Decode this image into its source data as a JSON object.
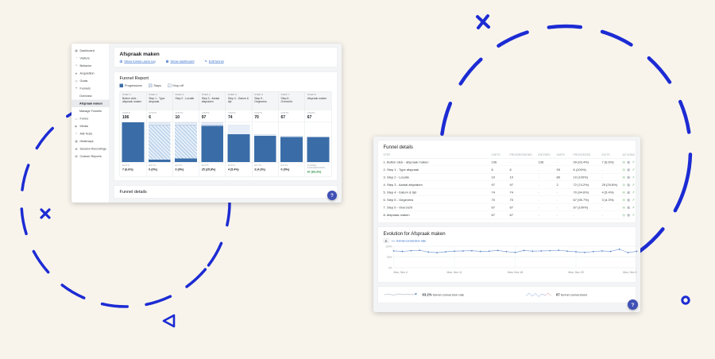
{
  "canvas": {
    "background": "#f8f4ec",
    "doodle_color": "#1c2bd3",
    "accent_blue": "#3f51b5"
  },
  "left_window": {
    "sidebar": {
      "items": [
        {
          "label": "Dashboard",
          "icon": "▦"
        },
        {
          "label": "Visitors",
          "icon": "◔"
        },
        {
          "label": "Behavior",
          "icon": "≡"
        },
        {
          "label": "Acquisition",
          "icon": "◈"
        },
        {
          "label": "Goals",
          "icon": "◎"
        },
        {
          "label": "Funnels",
          "icon": "⏷"
        },
        {
          "label": "Overview",
          "icon": "",
          "sub": true
        },
        {
          "label": "Afspraak maken",
          "icon": "",
          "sub": true,
          "active": true
        },
        {
          "label": "Manage Funnels",
          "icon": "",
          "sub": true
        },
        {
          "label": "Forms",
          "icon": "▭"
        },
        {
          "label": "Media",
          "icon": "▶"
        },
        {
          "label": "A/B Tests",
          "icon": "⌗"
        },
        {
          "label": "Heatmaps",
          "icon": "▩"
        },
        {
          "label": "Session Recordings",
          "icon": "◉"
        },
        {
          "label": "Custom Reports",
          "icon": "▤"
        }
      ]
    },
    "header": {
      "title": "Afspraak maken",
      "links": [
        {
          "icon": "▥",
          "label": "Show funnel users log"
        },
        {
          "icon": "▦",
          "label": "Show dashboard"
        },
        {
          "icon": "✎",
          "label": "Edit funnel"
        }
      ]
    },
    "report": {
      "title": "Funnel Report",
      "legend": [
        {
          "label": "Progressions",
          "type": "solid"
        },
        {
          "label": "Stays",
          "type": "hatch"
        },
        {
          "label": "Drop-off",
          "type": "light"
        }
      ],
      "visits_label": "VISITS",
      "exits_label": "EXITS",
      "conversions_label": "FUNNEL CONVERSIONS",
      "footer_label": "Funnel details",
      "help_label": "?"
    }
  },
  "right_window": {
    "details": {
      "title": "Funnel details",
      "columns": [
        "STEP",
        "VISITS",
        "PROGRESSIONS",
        "ENTRIES",
        "SKIPS",
        "PROCEEDED",
        "EXITS",
        "ACTIONS"
      ],
      "rows": [
        {
          "step": "1. Button click - afspraak maken",
          "visits": "106",
          "progressions": "-",
          "entries": "106",
          "skips": "-",
          "proceeded": "99 (93.4%)",
          "exits": "7 (6.6%)"
        },
        {
          "step": "2. Step 1 - Type afspraak",
          "visits": "6",
          "progressions": "6",
          "entries": "-",
          "skips": "93",
          "proceeded": "6 (100%)",
          "exits": "-"
        },
        {
          "step": "3. Step 2 - Locatie",
          "visits": "10",
          "progressions": "10",
          "entries": "-",
          "skips": "89",
          "proceeded": "10 (100%)",
          "exits": "-"
        },
        {
          "step": "4. Step 3 - Aantal afspraken",
          "visits": "97",
          "progressions": "97",
          "entries": "-",
          "skips": "2",
          "proceeded": "72 (74.2%)",
          "exits": "25 (25.8%)"
        },
        {
          "step": "5. Step 4 - Datum & tijd",
          "visits": "74",
          "progressions": "74",
          "entries": "-",
          "skips": "-",
          "proceeded": "70 (94.6%)",
          "exits": "4 (5.4%)"
        },
        {
          "step": "6. Step 5 - Gegevens",
          "visits": "70",
          "progressions": "70",
          "entries": "-",
          "skips": "-",
          "proceeded": "67 (95.7%)",
          "exits": "3 (4.3%)"
        },
        {
          "step": "7. Step 6 - Overzicht",
          "visits": "67",
          "progressions": "67",
          "entries": "-",
          "skips": "-",
          "proceeded": "67 (100%)",
          "exits": "-"
        },
        {
          "step": "8. Afspraak maken",
          "visits": "67",
          "progressions": "67",
          "entries": "-",
          "skips": "-",
          "proceeded": "-",
          "exits": "-"
        }
      ],
      "action_icons": [
        {
          "glyph": "◎",
          "name": "segment-icon",
          "color": "#6fae73"
        },
        {
          "glyph": "▦",
          "name": "table-icon",
          "color": "#98a1a8"
        },
        {
          "glyph": "↗",
          "name": "trend-icon",
          "color": "#6fae73"
        }
      ]
    },
    "evolution": {
      "title": "Evolution for Afspraak maken",
      "legend_icon": "▣",
      "legend_label": "funnel conversion rate"
    },
    "footer": {
      "stat1_value": "63.2%",
      "stat1_label": "funnel conversion rate",
      "stat2_value": "67",
      "stat2_label": "funnel conversions"
    },
    "help_label": "?"
  },
  "chart_data": [
    {
      "type": "bar",
      "title": "Funnel Report",
      "legend": [
        "Progressions",
        "Stays",
        "Drop-off"
      ],
      "ylim": [
        0,
        106
      ],
      "columns": [
        {
          "step": "STEP 1",
          "name": "Button click - afspraak maken",
          "visits": "106",
          "exits": "7 (6.6%)",
          "stack": {
            "solid": 100,
            "hatch": 0,
            "light": 0
          }
        },
        {
          "step": "STEP 2",
          "name": "Step 1 - Type afspraak",
          "visits": "6",
          "exits": "0 (0%)",
          "stack": {
            "solid": 5.7,
            "hatch": 87.7,
            "light": 6.6
          }
        },
        {
          "step": "STEP 3",
          "name": "Step 2 - Locatie",
          "visits": "10",
          "exits": "0 (0%)",
          "stack": {
            "solid": 9.4,
            "hatch": 84.0,
            "light": 6.6
          }
        },
        {
          "step": "STEP 4",
          "name": "Step 3 - Aantal afspraken",
          "visits": "97",
          "exits": "25 (25.8%)",
          "stack": {
            "solid": 91.5,
            "hatch": 1.9,
            "light": 6.6
          }
        },
        {
          "step": "STEP 5",
          "name": "Step 4 - Datum & tijd",
          "visits": "74",
          "exits": "4 (5.4%)",
          "stack": {
            "solid": 69.8,
            "hatch": 0,
            "light": 23.6
          }
        },
        {
          "step": "STEP 6",
          "name": "Step 5 - Gegevens",
          "visits": "70",
          "exits": "3 (4.3%)",
          "stack": {
            "solid": 66.0,
            "hatch": 0,
            "light": 3.8
          }
        },
        {
          "step": "STEP 7",
          "name": "Step 6 - Overzicht",
          "visits": "67",
          "exits": "0 (0%)",
          "stack": {
            "solid": 63.2,
            "hatch": 0,
            "light": 2.8
          }
        },
        {
          "step": "STEP 8",
          "name": "Afspraak maken",
          "visits": "67",
          "exits": "67 (63.2%)",
          "conversion": true,
          "stack": {
            "solid": 63.2,
            "hatch": 0,
            "light": 0
          }
        }
      ]
    },
    {
      "type": "line",
      "title": "Evolution for Afspraak maken",
      "series_label": "funnel conversion rate",
      "ylim": [
        0,
        100
      ],
      "yticks": [
        {
          "label": "100%",
          "value": 100
        },
        {
          "label": "50%",
          "value": 50
        },
        {
          "label": "0%",
          "value": 0
        }
      ],
      "x_tick_indices": [
        0,
        7,
        14,
        21,
        28
      ],
      "x_tick_labels": [
        "Mon, Nov 4",
        "Mon, Nov 11",
        "Mon, Nov 18",
        "Mon, Nov 25",
        "Mon, Dec 2"
      ],
      "values": [
        78,
        76,
        79,
        81,
        73,
        70,
        74,
        77,
        78,
        79,
        76,
        77,
        80,
        75,
        71,
        80,
        77,
        78,
        79,
        81,
        77,
        74,
        71,
        75,
        78,
        76,
        86,
        70,
        76
      ]
    }
  ]
}
